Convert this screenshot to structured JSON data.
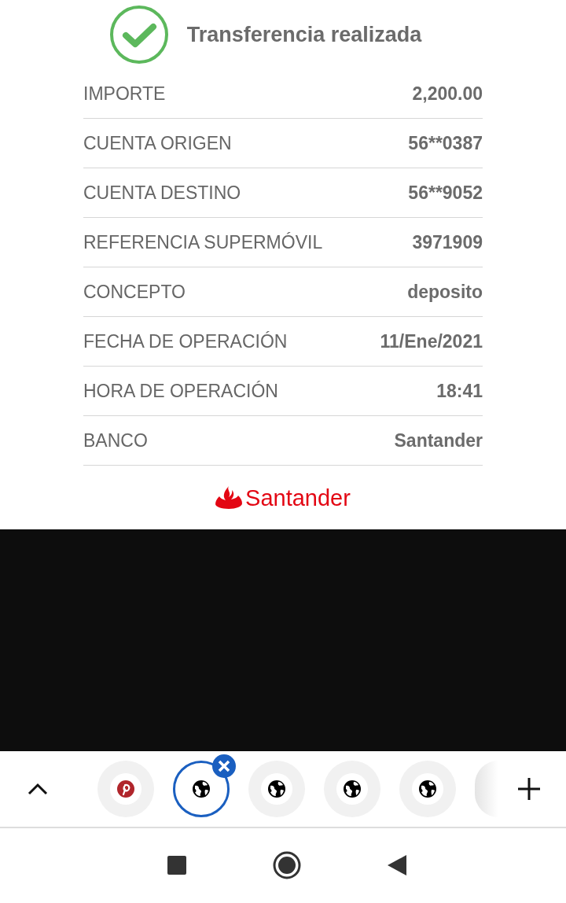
{
  "header": {
    "title": "Transferencia realizada"
  },
  "details": [
    {
      "label": "IMPORTE",
      "value": "2,200.00"
    },
    {
      "label": "CUENTA ORIGEN",
      "value": "56**0387"
    },
    {
      "label": "CUENTA DESTINO",
      "value": "56**9052"
    },
    {
      "label": "REFERENCIA SUPERMÓVIL",
      "value": "3971909"
    },
    {
      "label": "CONCEPTO",
      "value": "deposito"
    },
    {
      "label": "FECHA DE OPERACIÓN",
      "value": "11/Ene/2021"
    },
    {
      "label": "HORA DE OPERACIÓN",
      "value": "18:41"
    },
    {
      "label": "BANCO",
      "value": "Santander"
    }
  ],
  "logo": {
    "text": "Santander"
  },
  "tab_bar": {
    "tabs": [
      {
        "kind": "pinterest",
        "selected": false
      },
      {
        "kind": "globe",
        "selected": true
      },
      {
        "kind": "globe",
        "selected": false
      },
      {
        "kind": "globe",
        "selected": false
      },
      {
        "kind": "globe",
        "selected": false
      }
    ]
  }
}
